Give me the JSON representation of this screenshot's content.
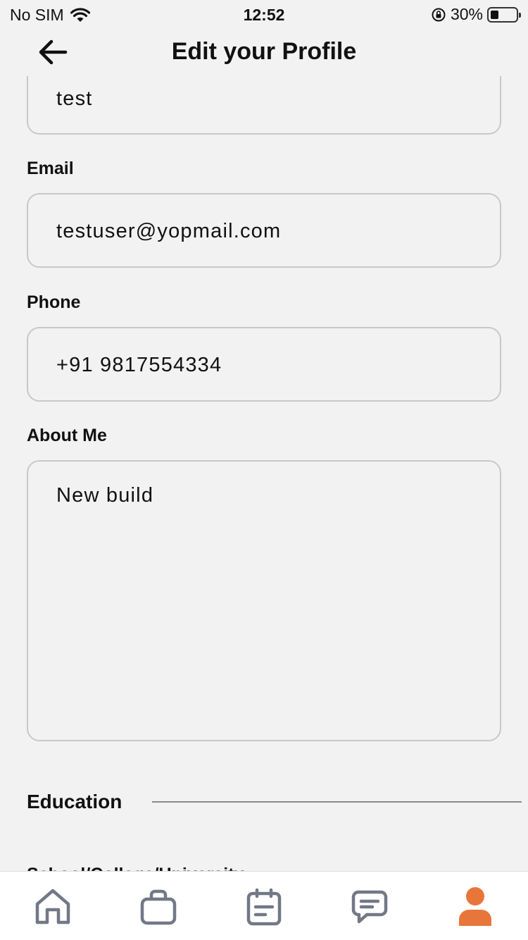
{
  "status_bar": {
    "carrier": "No SIM",
    "time": "12:52",
    "battery_percent": "30%",
    "battery_level": 0.3
  },
  "header": {
    "title": "Edit your Profile"
  },
  "form": {
    "name_value": "test",
    "email_label": "Email",
    "email_value": "testuser@yopmail.com",
    "phone_label": "Phone",
    "phone_value": "+91 9817554334",
    "about_label": "About Me",
    "about_value": "New build"
  },
  "education": {
    "heading": "Education",
    "next_field_label": "School/College/University"
  },
  "tab_bar": {
    "active": "profile",
    "active_color": "#e8763a",
    "inactive_color": "#727886",
    "items": [
      "home-icon",
      "briefcase-icon",
      "calendar-icon",
      "chat-icon",
      "profile-icon"
    ]
  }
}
